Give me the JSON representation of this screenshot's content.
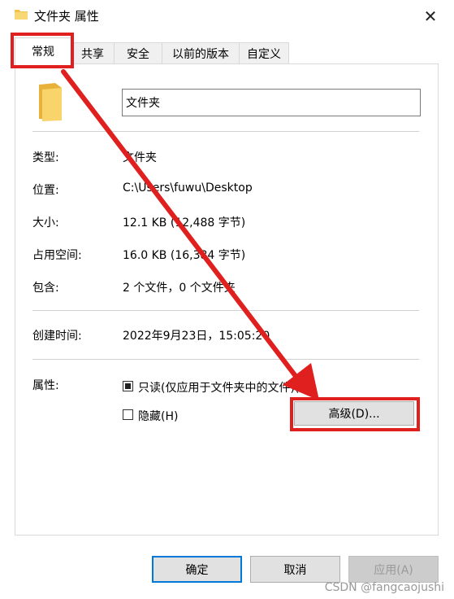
{
  "window": {
    "title": "文件夹 属性",
    "close_icon": "close-icon"
  },
  "tabs": [
    {
      "label": "常规",
      "active": true
    },
    {
      "label": "共享"
    },
    {
      "label": "安全"
    },
    {
      "label": "以前的版本"
    },
    {
      "label": "自定义"
    }
  ],
  "general": {
    "folder_name": "文件夹",
    "props": [
      {
        "label": "类型:",
        "value": "文件夹"
      },
      {
        "label": "位置:",
        "value": "C:\\Users\\fuwu\\Desktop"
      },
      {
        "label": "大小:",
        "value": "12.1 KB (12,488 字节)"
      },
      {
        "label": "占用空间:",
        "value": "16.0 KB (16,384 字节)"
      },
      {
        "label": "包含:",
        "value": "2 个文件，0 个文件夹"
      },
      {
        "label": "创建时间:",
        "value": "2022年9月23日，15:05:20"
      }
    ],
    "attributes_label": "属性:",
    "readonly_label": "只读(仅应用于文件夹中的文件)(R)",
    "readonly_checked": true,
    "hidden_label": "隐藏(H)",
    "hidden_checked": false,
    "advanced_button": "高级(D)..."
  },
  "footer": {
    "ok": "确定",
    "cancel": "取消",
    "apply": "应用(A)"
  },
  "watermark": "CSDN @fangcaojushi",
  "colors": {
    "annotation": "#e01f1f",
    "folder": "#f2c14e",
    "default_border": "#0078d7"
  }
}
